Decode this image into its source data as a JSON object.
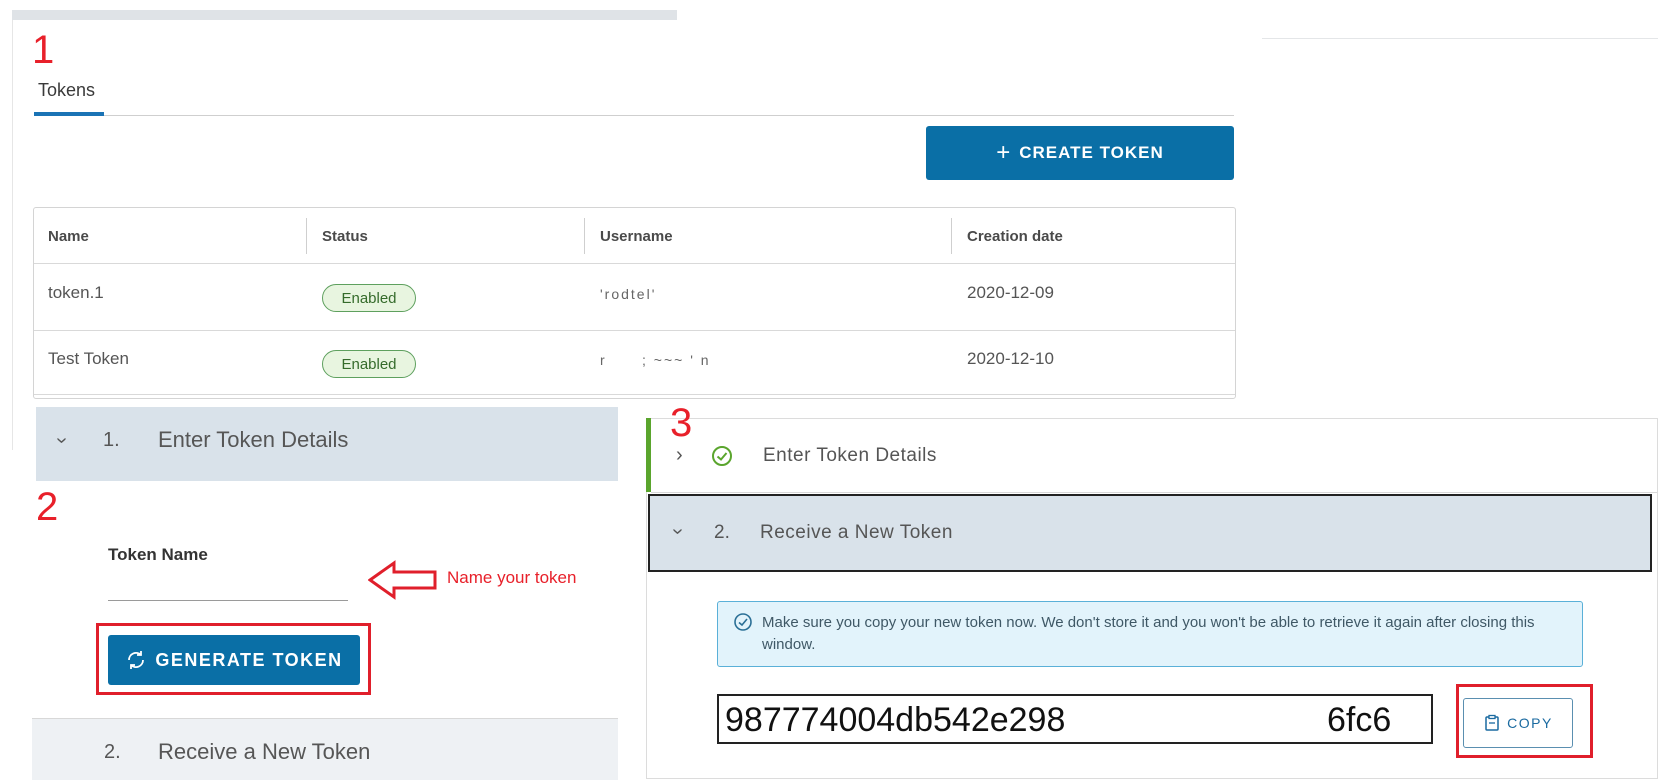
{
  "steps": {
    "one": "1",
    "two": "2",
    "three": "3"
  },
  "panel1": {
    "tab_label": "Tokens",
    "create_button": "CREATE TOKEN",
    "table": {
      "headers": [
        "Name",
        "Status",
        "Username",
        "Creation date"
      ],
      "rows": [
        {
          "name": "token.1",
          "status": "Enabled",
          "username": "'rodtel'",
          "date": "2020-12-09"
        },
        {
          "name": "Test Token",
          "status": "Enabled",
          "username": "r      ; ~~~ ' n",
          "date": "2020-12-10"
        }
      ]
    }
  },
  "panel2": {
    "step1_num": "1.",
    "step1_title": "Enter Token Details",
    "token_name_label": "Token Name",
    "token_name_value": "",
    "annotation": "Name your token",
    "generate_button": "GENERATE TOKEN",
    "step2_num": "2.",
    "step2_title": "Receive a New Token"
  },
  "panel3": {
    "step1_title": "Enter Token Details",
    "step2_num": "2.",
    "step2_title": "Receive a New Token",
    "info_message": "Make sure you copy your new token now. We don't store it and you won't be able to retrieve it again after closing this window.",
    "token_start": "987774004db542e298",
    "token_end": "6fc6",
    "copy_button": "COPY"
  },
  "colors": {
    "accent": "#0a6fa6",
    "annotation_red": "#e01f2b",
    "success_green": "#5aa52d"
  }
}
